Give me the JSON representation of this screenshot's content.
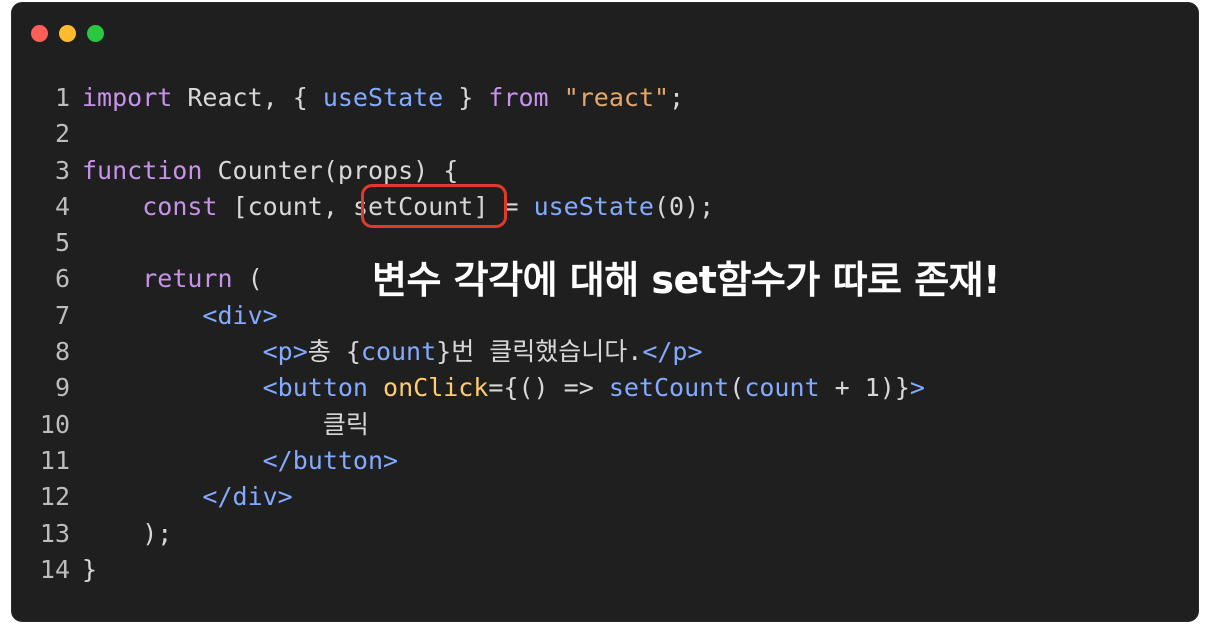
{
  "window": {
    "controls": [
      "close",
      "minimize",
      "maximize"
    ]
  },
  "code": {
    "lines": [
      {
        "n": "1",
        "tokens": [
          [
            "kw",
            "import"
          ],
          [
            "pl",
            " React, { "
          ],
          [
            "fn",
            "useState"
          ],
          [
            "pl",
            " } "
          ],
          [
            "kw",
            "from"
          ],
          [
            "pl",
            " "
          ],
          [
            "str",
            "\"react\""
          ],
          [
            "pl",
            ";"
          ]
        ]
      },
      {
        "n": "2",
        "tokens": []
      },
      {
        "n": "3",
        "tokens": [
          [
            "kw",
            "function"
          ],
          [
            "pl",
            " Counter(props) {"
          ]
        ]
      },
      {
        "n": "4",
        "tokens": [
          [
            "pl",
            "    "
          ],
          [
            "kw",
            "const"
          ],
          [
            "pl",
            " [count, setCount] = "
          ],
          [
            "fn",
            "useState"
          ],
          [
            "pl",
            "(0);"
          ]
        ]
      },
      {
        "n": "5",
        "tokens": []
      },
      {
        "n": "6",
        "tokens": [
          [
            "pl",
            "    "
          ],
          [
            "kw",
            "return"
          ],
          [
            "pl",
            " ("
          ]
        ]
      },
      {
        "n": "7",
        "tokens": [
          [
            "pl",
            "        "
          ],
          [
            "tag",
            "<div>"
          ]
        ]
      },
      {
        "n": "8",
        "tokens": [
          [
            "pl",
            "            "
          ],
          [
            "tag",
            "<p>"
          ],
          [
            "pl",
            "총 {"
          ],
          [
            "hl",
            "count"
          ],
          [
            "pl",
            "}번 클릭했습니다."
          ],
          [
            "tag",
            "</p>"
          ]
        ]
      },
      {
        "n": "9",
        "tokens": [
          [
            "pl",
            "            "
          ],
          [
            "tag",
            "<button "
          ],
          [
            "attr",
            "onClick"
          ],
          [
            "pl",
            "={() => "
          ],
          [
            "fn",
            "setCount"
          ],
          [
            "pl",
            "("
          ],
          [
            "hl",
            "count"
          ],
          [
            "pl",
            " + 1)}"
          ],
          [
            "tag",
            ">"
          ]
        ]
      },
      {
        "n": "10",
        "tokens": [
          [
            "pl",
            "                클릭"
          ]
        ]
      },
      {
        "n": "11",
        "tokens": [
          [
            "pl",
            "            "
          ],
          [
            "tag",
            "</button>"
          ]
        ]
      },
      {
        "n": "12",
        "tokens": [
          [
            "pl",
            "        "
          ],
          [
            "tag",
            "</div>"
          ]
        ]
      },
      {
        "n": "13",
        "tokens": [
          [
            "pl",
            "    );"
          ]
        ]
      },
      {
        "n": "14",
        "tokens": [
          [
            "pl",
            "}"
          ]
        ]
      }
    ]
  },
  "annotation": {
    "caption": "변수 각각에 대해 set함수가 따로 존재!",
    "highlight_color": "#e23a2a"
  }
}
